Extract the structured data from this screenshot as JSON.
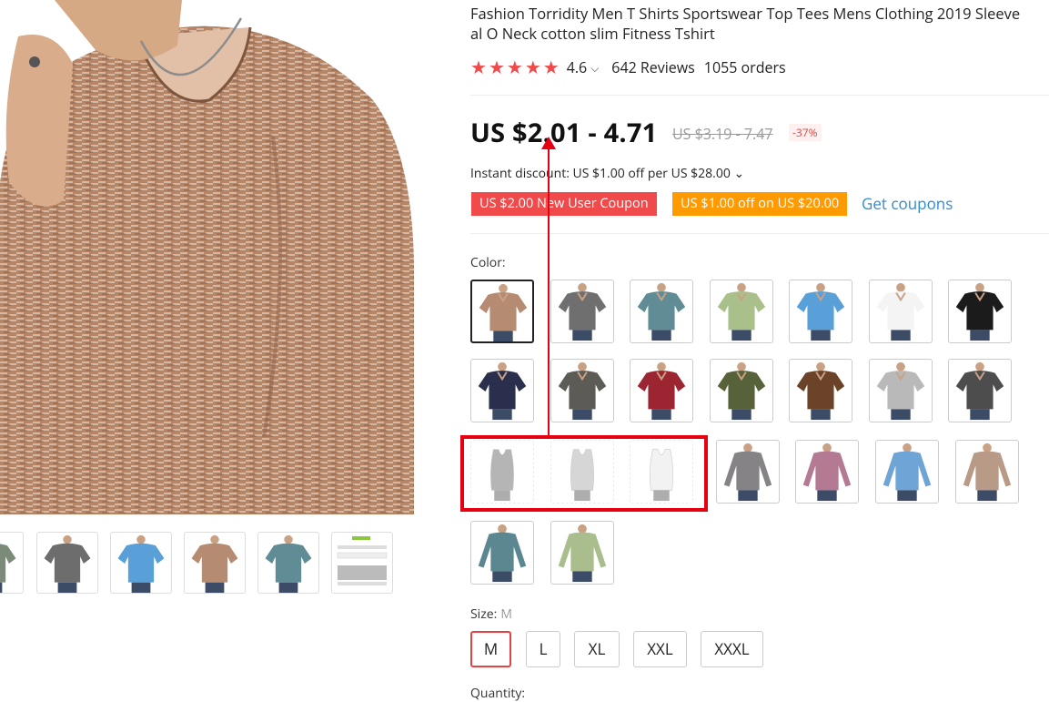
{
  "product": {
    "title": "Fashion Torridity Men T Shirts Sportswear Top Tees Mens Clothing 2019 Sleeve\nal O Neck cotton slim Fitness Tshirt",
    "rating": "4.6",
    "reviews": "642 Reviews",
    "orders": "1055 orders",
    "price": "US $2.01 - 4.71",
    "old_price": "US $3.19 - 7.47",
    "discount": "-37%",
    "instant_discount": "Instant discount: US $1.00 off per US $28.00 ⌄"
  },
  "coupons": {
    "new_user": "US $2.00 New User Coupon",
    "store": "US $1.00 off on US $20.00",
    "get_coupons": "Get coupons"
  },
  "color": {
    "label": "Color:",
    "swatches": [
      {
        "name": "heather-brown",
        "body": "#b58b72",
        "state": "selected"
      },
      {
        "name": "heather-gray",
        "body": "#6f6f70",
        "state": "normal"
      },
      {
        "name": "heather-teal",
        "body": "#5f8c95",
        "state": "normal"
      },
      {
        "name": "light-green",
        "body": "#a9c08a",
        "state": "normal"
      },
      {
        "name": "heather-sky-blue",
        "body": "#5aa0d8",
        "state": "normal"
      },
      {
        "name": "white",
        "body": "#f4f4f4",
        "state": "normal"
      },
      {
        "name": "black",
        "body": "#1b1b1b",
        "state": "normal"
      },
      {
        "name": "navy",
        "body": "#2a2f4d",
        "state": "normal"
      },
      {
        "name": "charcoal",
        "body": "#5d5b55",
        "state": "normal"
      },
      {
        "name": "burgundy",
        "body": "#9b2530",
        "state": "normal"
      },
      {
        "name": "army-green",
        "body": "#57623a",
        "state": "normal"
      },
      {
        "name": "brown",
        "body": "#6a4328",
        "state": "normal"
      },
      {
        "name": "light-gray",
        "body": "#b9b9b9",
        "state": "normal"
      },
      {
        "name": "dark-gray",
        "body": "#4d4d4d",
        "state": "normal"
      },
      {
        "name": "tank-dark-gray",
        "body": "#7a7a7a",
        "state": "disabled"
      },
      {
        "name": "tank-gray",
        "body": "#b5b5b5",
        "state": "disabled"
      },
      {
        "name": "tank-white",
        "body": "#e8e8e8",
        "state": "disabled"
      },
      {
        "name": "long-heather-gray",
        "body": "#858385",
        "state": "normal"
      },
      {
        "name": "long-heather-pink",
        "body": "#b47a94",
        "state": "normal"
      },
      {
        "name": "long-heather-blue",
        "body": "#6ea4d6",
        "state": "normal"
      },
      {
        "name": "long-heather-brown",
        "body": "#b89a86",
        "state": "normal"
      },
      {
        "name": "long-heather-teal",
        "body": "#5b8790",
        "state": "normal"
      },
      {
        "name": "long-light-green",
        "body": "#a9be8c",
        "state": "normal"
      }
    ]
  },
  "size": {
    "label": "Size:",
    "selected": "M",
    "options": [
      "M",
      "L",
      "XL",
      "XXL",
      "XXXL"
    ]
  },
  "quantity": {
    "label": "Quantity:"
  },
  "thumbs": [
    {
      "name": "thumb-partial",
      "body": "#7c8a7a"
    },
    {
      "name": "thumb-gray",
      "body": "#6d6d6d"
    },
    {
      "name": "thumb-blue",
      "body": "#5aa0d8"
    },
    {
      "name": "thumb-brown",
      "body": "#b58b72"
    },
    {
      "name": "thumb-teal",
      "body": "#5f8c95"
    },
    {
      "name": "thumb-size-chart",
      "body": "#cccccc"
    }
  ],
  "colors": {
    "star": "#f04a4a",
    "annotation": "#e60012",
    "coupon_red": "#f04a4a",
    "coupon_orange": "#ff9a00",
    "link": "#2e8ccf"
  }
}
